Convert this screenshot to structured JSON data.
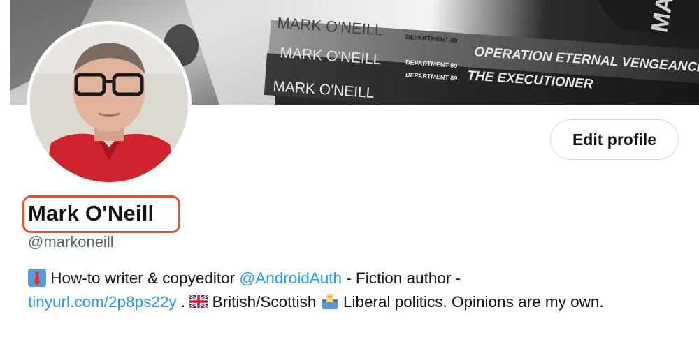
{
  "banner": {
    "books": [
      {
        "author": "MARK O'NEILL",
        "series": "DEPARTMENT 89",
        "title": ""
      },
      {
        "author": "MARK O'NEILL",
        "series": "DEPARTMENT 89",
        "title": "OPERATION ETERNAL VENGEANCE"
      },
      {
        "author": "MARK O'NEILL",
        "series": "DEPARTMENT 89",
        "title": "THE EXECUTIONER"
      }
    ]
  },
  "profile": {
    "name": "Mark O'Neill",
    "handle": "@markoneill",
    "edit_button": "Edit profile"
  },
  "bio": {
    "part1": "How-to writer & copyeditor ",
    "mention": "@AndroidAuth",
    "part2": " - Fiction author -",
    "link": "tinyurl.com/2p8ps22y",
    "part3": " . ",
    "part4": " British/Scottish ",
    "part5": " Liberal politics. Opinions are my own.",
    "icons": [
      "necktie-icon",
      "uk-flag-icon",
      "ballot-box-icon"
    ]
  },
  "colors": {
    "link": "#1d9bf0",
    "highlight": "#e0532f",
    "text": "#0f1419",
    "muted": "#536471"
  }
}
